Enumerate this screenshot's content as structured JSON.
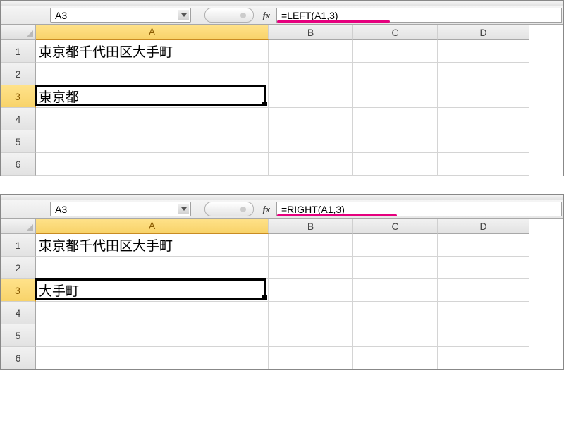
{
  "sheets": [
    {
      "active_cell_ref": "A3",
      "fx_label": "fx",
      "formula": "=LEFT(A1,3)",
      "underline": {
        "left": 0,
        "width": 160
      },
      "col_labels": [
        "A",
        "B",
        "C",
        "D"
      ],
      "active_col_index": 0,
      "active_row_index": 2,
      "row_labels": [
        "1",
        "2",
        "3",
        "4",
        "5",
        "6"
      ],
      "cells": {
        "A1": "東京都千代田区大手町",
        "A3": "東京都"
      }
    },
    {
      "active_cell_ref": "A3",
      "fx_label": "fx",
      "formula": "=RIGHT(A1,3)",
      "underline": {
        "left": 0,
        "width": 170
      },
      "col_labels": [
        "A",
        "B",
        "C",
        "D"
      ],
      "active_col_index": 0,
      "active_row_index": 2,
      "row_labels": [
        "1",
        "2",
        "3",
        "4",
        "5",
        "6"
      ],
      "cells": {
        "A1": "東京都千代田区大手町",
        "A3": "大手町"
      }
    }
  ]
}
